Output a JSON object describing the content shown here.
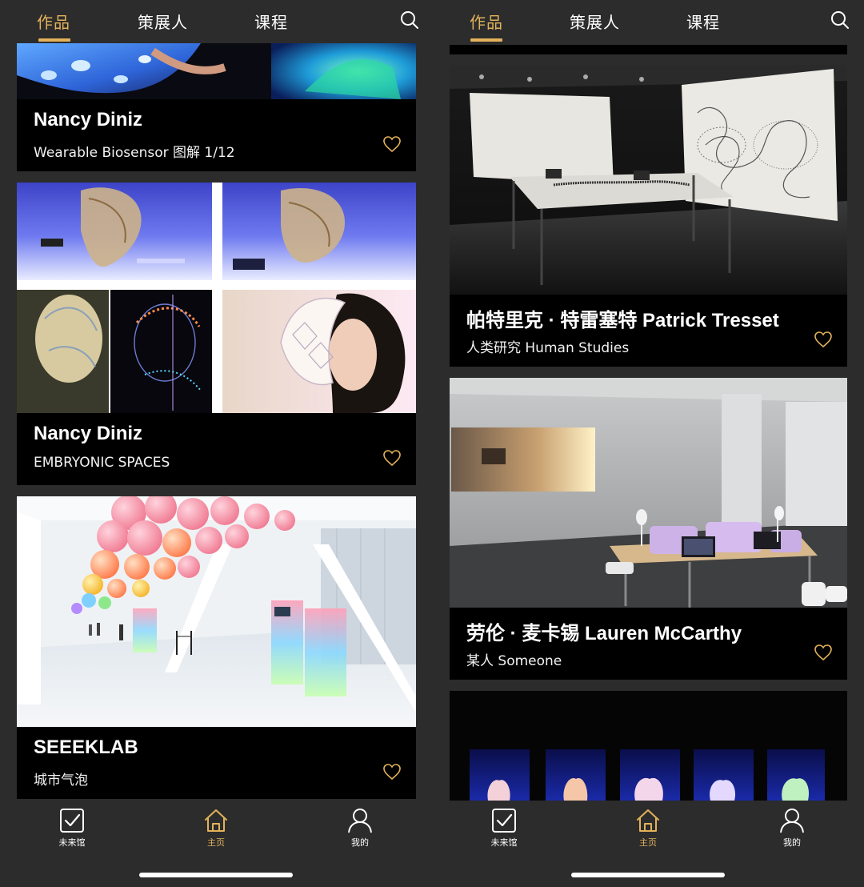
{
  "colors": {
    "accent": "#e2b25b",
    "background": "#2c2c2c",
    "card": "#000000",
    "text": "#ffffff"
  },
  "nav": {
    "tabs": [
      "作品",
      "策展人",
      "课程"
    ],
    "active_index": 0,
    "search_icon": "search-icon"
  },
  "left": {
    "cards": [
      {
        "title": "Nancy Diniz",
        "subtitle": "Wearable Biosensor 图解 1/12",
        "favorite": "heart-outline-icon"
      },
      {
        "title": "Nancy Diniz",
        "subtitle": "EMBRYONIC SPACES",
        "favorite": "heart-outline-icon"
      },
      {
        "title": "SEEEKLAB",
        "subtitle": "城市气泡",
        "favorite": "heart-outline-icon"
      }
    ]
  },
  "right": {
    "cards": [
      {
        "title": "帕特里克 · 特雷塞特 Patrick Tresset",
        "subtitle": "人类研究 Human Studies",
        "favorite": "heart-outline-icon"
      },
      {
        "title": "劳伦 · 麦卡锡 Lauren McCarthy",
        "subtitle": "某人 Someone",
        "favorite": "heart-outline-icon"
      }
    ]
  },
  "tabbar": {
    "items": [
      "未来馆",
      "主页",
      "我的"
    ],
    "active_index": 1
  }
}
